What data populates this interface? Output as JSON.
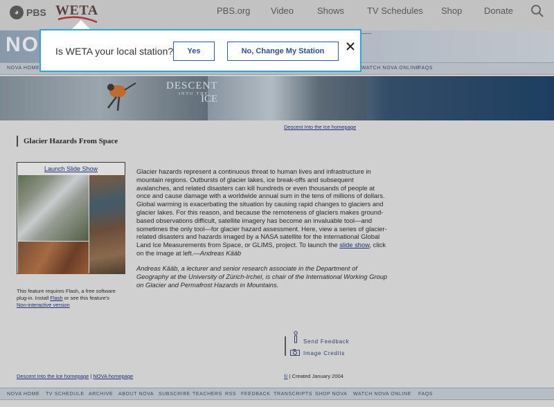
{
  "header": {
    "pbs_logo": "PBS",
    "station_logo": "WETA",
    "nav": [
      "PBS.org",
      "Video",
      "Shows",
      "TV Schedules",
      "Shop",
      "Donate"
    ]
  },
  "nova": {
    "logo_text": "NOVA",
    "nav_top": [
      "NOVA HOME",
      "WATCH NOVA ONLINE",
      "FAQS"
    ],
    "nav_bottom": [
      "NOVA HOME",
      "TV SCHEDULE",
      "ARCHIVE",
      "ABOUT NOVA",
      "SUBSCRIBE",
      "TEACHERS",
      "RSS",
      "FEEDBACK",
      "TRANSCRIPTS",
      "SHOP NOVA",
      "WATCH NOVA ONLINE",
      "FAQS"
    ]
  },
  "banner": {
    "title_line1": "DESCENT",
    "title_line2": "INTO THE",
    "title_line3": "ICE"
  },
  "homepage_link": "Descent Into the Ice homepage",
  "page_title": "Glacier Hazards From Space",
  "slideshow": {
    "launch_label": "Launch Slide Show"
  },
  "flash_note": {
    "text1": "This feature requires Flash, a free software plug-in. Install ",
    "flash_link": "Flash",
    "text2": " or see this feature's",
    "noninteractive_link": "Non-interactive version"
  },
  "body": {
    "para1_before": "Glacier hazards represent a continuous threat to human lives and infrastructure in mountain regions. Outbursts of glacier lakes, ice break-offs and subsequent avalanches, and related disasters can kill hundreds or even thousands of people at once and cause damage with a worldwide annual sum in the tens of millions of dollars. Global warming is exacerbating the situation by causing rapid changes to glaciers and glacier lakes. For this reason, and because the remoteness of glaciers makes ground-based observations difficult, satellite imagery has become an invaluable tool—and sometimes the only tool—for glacier hazard assessment. Here, view a series of glacier-related disasters and hazards imaged by a NASA satellite for the international Global Land Ice Measurements from Space, or GLIMS, project. To launch the ",
    "slide_show_link": "slide show",
    "para1_after": ", click on the image at left.",
    "signature": "—Andreas Kääb",
    "byline": "Andreas Kääb, a lecturer and senior research associate in the Department of Geography at the University of Zürich-Irchel, is chair of the International Working Group on Glacier and Permafrost Hazards in Mountains."
  },
  "side_links": {
    "send_feedback": "Send Feedback",
    "image_credits": "Image Credits"
  },
  "footer": {
    "homepage_link": "Descent Into the Ice homepage",
    "separator": " | ",
    "nova_homepage_link": "NOVA homepage",
    "copyright_symbol": "©",
    "created": " | Created January 2004"
  },
  "modal": {
    "question": "Is WETA your local station?",
    "yes_label": "Yes",
    "no_label": "No, Change My Station"
  },
  "colors": {
    "modal_border": "#2aa7d6",
    "button_text": "#2a4f9a",
    "link": "#1a2a7a"
  }
}
